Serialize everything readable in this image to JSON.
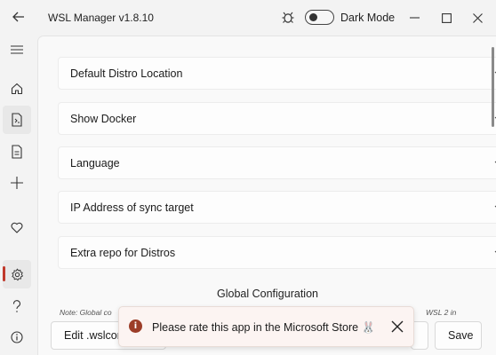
{
  "window": {
    "title": "WSL Manager v1.8.10",
    "dark_mode_label": "Dark Mode",
    "dark_mode_on": false
  },
  "nav": {
    "items": [
      "menu-icon",
      "home-icon",
      "distro-icon",
      "file-icon",
      "add-icon",
      "heart-icon",
      "settings-icon",
      "help-icon",
      "info-icon"
    ],
    "active": "settings-icon"
  },
  "settings": {
    "expanders": [
      {
        "label": "Default Distro Location"
      },
      {
        "label": "Show Docker"
      },
      {
        "label": "Language"
      },
      {
        "label": "IP Address of sync target"
      },
      {
        "label": "Extra repo for Distros"
      }
    ],
    "section_heading": "Global Configuration",
    "note_left": "Note: Global co",
    "note_right": "WSL 2 in"
  },
  "buttons": {
    "edit_wslconfig": "Edit .wslconfig",
    "save": "Save"
  },
  "toast": {
    "message": "Please rate this app in the Microsoft Store 🐰",
    "icon": "info-icon"
  },
  "colors": {
    "accent": "#c0392b",
    "toast_icon": "#9c3d28"
  }
}
